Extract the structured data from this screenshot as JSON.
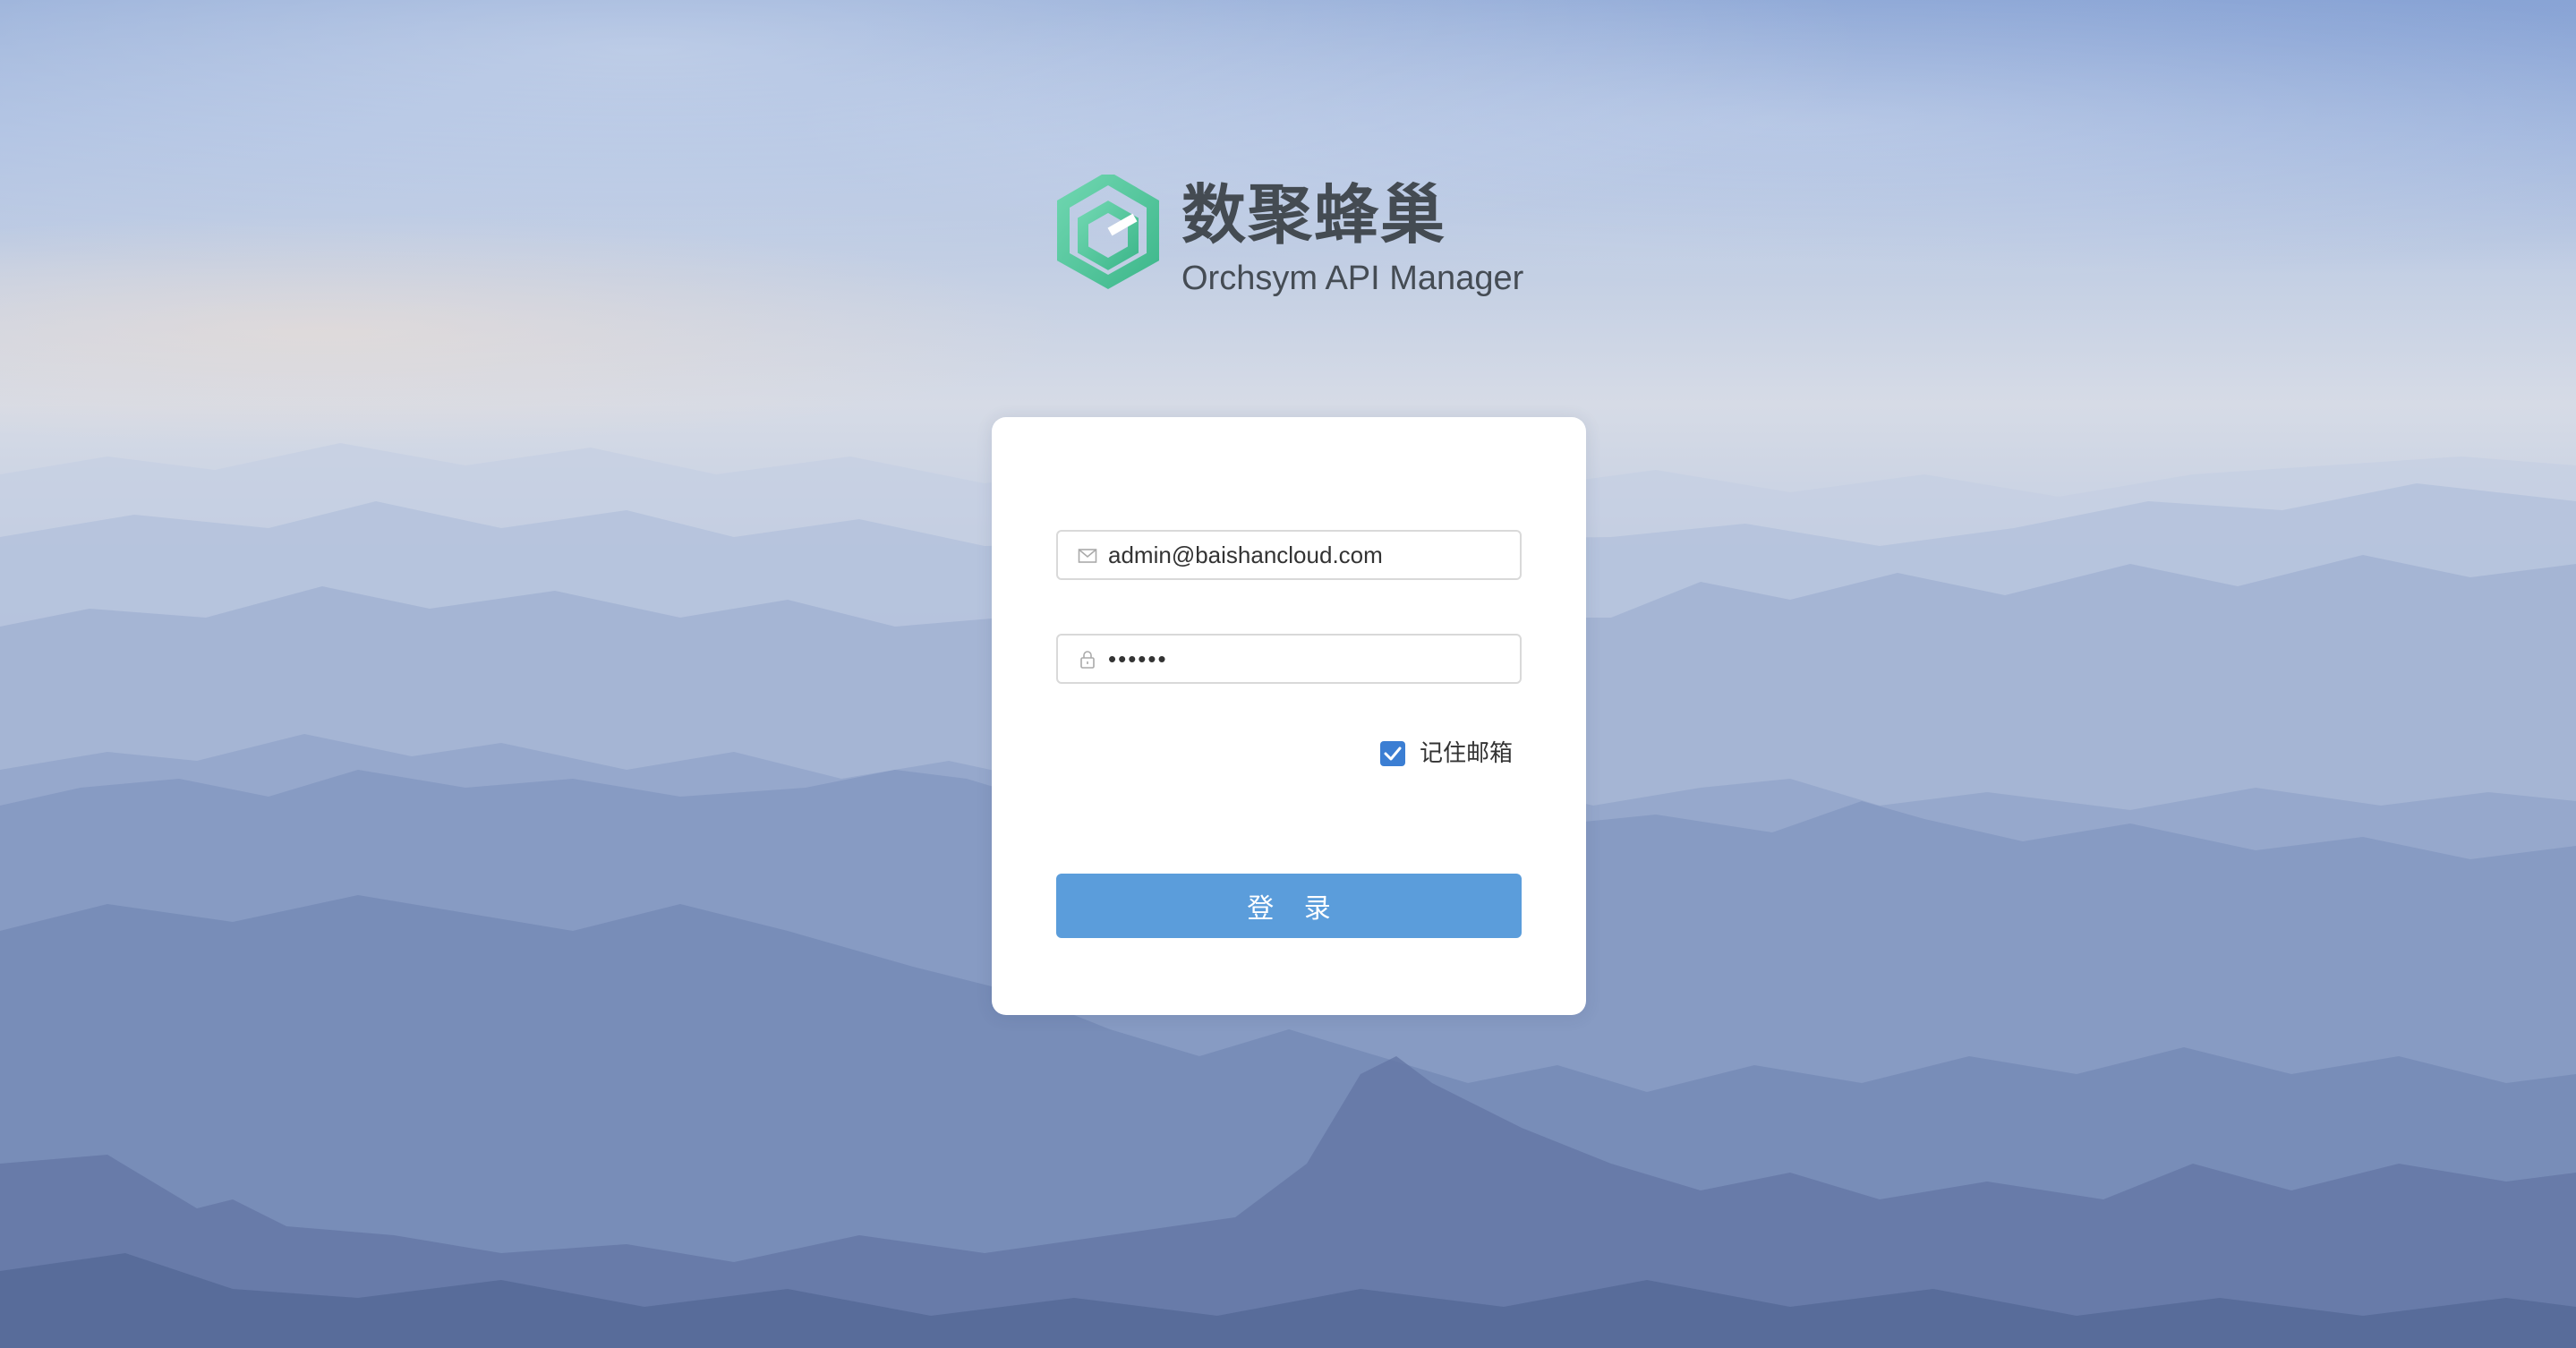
{
  "brand": {
    "name_cn": "数聚蜂巢",
    "name_en": "Orchsym API Manager",
    "logo_icon": "hexagon-logo-icon",
    "logo_color": "#5cc9a0"
  },
  "login_form": {
    "email": {
      "icon": "mail-icon",
      "value": "admin@baishancloud.com"
    },
    "password": {
      "icon": "lock-icon",
      "value": "••••••"
    },
    "remember": {
      "label": "记住邮箱",
      "checked": true,
      "color": "#3b7ed3"
    },
    "submit_label": "登 录",
    "submit_color": "#5b9ddb"
  }
}
